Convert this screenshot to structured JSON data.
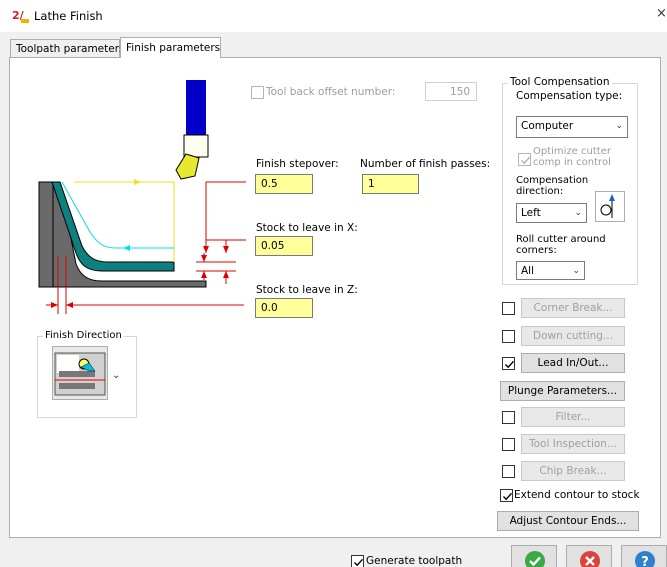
{
  "window": {
    "title": "Lathe Finish",
    "close_glyph": "×"
  },
  "tabs": [
    {
      "label": "Toolpath parameters",
      "active": false
    },
    {
      "label": "Finish parameters",
      "active": true
    }
  ],
  "tool_back_offset": {
    "label": "Tool back offset number:",
    "value": "150",
    "enabled": false,
    "checked": false
  },
  "finish_stepover": {
    "label": "Finish stepover:",
    "value": "0.5"
  },
  "finish_passes": {
    "label": "Number of finish passes:",
    "value": "1"
  },
  "stock_x": {
    "label": "Stock to leave in X:",
    "value": "0.05"
  },
  "stock_z": {
    "label": "Stock to leave in Z:",
    "value": "0.0"
  },
  "finish_direction": {
    "label": "Finish Direction"
  },
  "tool_compensation": {
    "group_label": "Tool Compensation",
    "type_label": "Compensation type:",
    "type_value": "Computer",
    "optimize_label": "Optimize cutter comp in control",
    "optimize_checked": true,
    "optimize_enabled": false,
    "direction_label": "Compensation direction:",
    "direction_value": "Left",
    "roll_label": "Roll cutter around corners:",
    "roll_value": "All"
  },
  "options": [
    {
      "label": "Corner Break...",
      "checked": false,
      "enabled": false
    },
    {
      "label": "Down cutting...",
      "checked": false,
      "enabled": false
    },
    {
      "label": "Lead In/Out...",
      "checked": true,
      "enabled": true
    }
  ],
  "plunge_button": "Plunge Parameters...",
  "options2": [
    {
      "label": "Filter...",
      "checked": false,
      "enabled": false
    },
    {
      "label": "Tool Inspection...",
      "checked": false,
      "enabled": false
    },
    {
      "label": "Chip Break...",
      "checked": false,
      "enabled": false
    }
  ],
  "extend_contour": {
    "label": "Extend contour to stock",
    "checked": true
  },
  "adjust_button": "Adjust Contour Ends...",
  "generate_toolpath": {
    "label": "Generate toolpath",
    "checked": true
  },
  "colors": {
    "ok": "#3aa845",
    "cancel": "#d9433b",
    "help": "#2f7fc9",
    "highlight_input": "#ffff99"
  }
}
